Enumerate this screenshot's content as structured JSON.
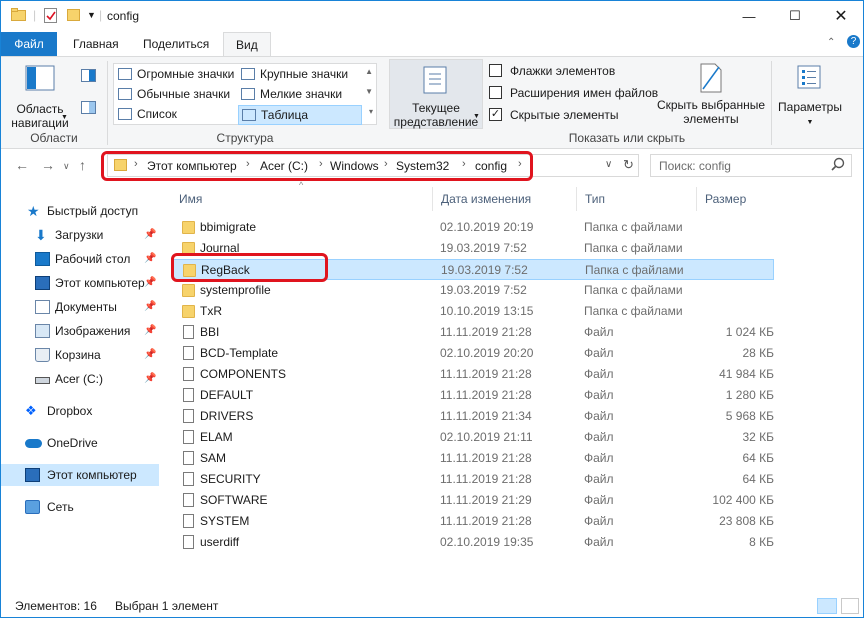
{
  "title": "config",
  "tabs": [
    {
      "label": "Файл"
    },
    {
      "label": "Главная"
    },
    {
      "label": "Поделиться"
    },
    {
      "label": "Вид"
    }
  ],
  "ribbon": {
    "nav_area_label": "Область\nнавигации",
    "group_panels": "Области",
    "layouts": {
      "huge": "Огромные значки",
      "large": "Крупные значки",
      "normal": "Обычные значки",
      "small": "Мелкие значки",
      "list": "Список",
      "table": "Таблица"
    },
    "group_structure": "Структура",
    "current_view": "Текущее\nпредставление",
    "checkboxes": {
      "item_flags": "Флажки элементов",
      "extensions": "Расширения имен файлов",
      "hidden": "Скрытые элементы"
    },
    "hide_selected": "Скрыть выбранные\nэлементы",
    "group_show_hide": "Показать или скрыть",
    "parameters": "Параметры"
  },
  "address": {
    "crumbs": [
      "Этот компьютер",
      "Acer (C:)",
      "Windows",
      "System32",
      "config"
    ],
    "search_placeholder": "Поиск: config"
  },
  "nav": {
    "quick_access": "Быстрый доступ",
    "items": [
      {
        "label": "Загрузки"
      },
      {
        "label": "Рабочий стол"
      },
      {
        "label": "Этот компьютер"
      },
      {
        "label": "Документы"
      },
      {
        "label": "Изображения"
      },
      {
        "label": "Корзина"
      },
      {
        "label": "Acer (C:)"
      }
    ],
    "dropbox": "Dropbox",
    "onedrive": "OneDrive",
    "this_pc": "Этот компьютер",
    "network": "Сеть"
  },
  "columns": {
    "name": "Имя",
    "date": "Дата изменения",
    "type": "Тип",
    "size": "Размер"
  },
  "files": [
    {
      "name": "bbimigrate",
      "date": "02.10.2019 20:19",
      "type": "Папка с файлами",
      "size": "",
      "kind": "folder"
    },
    {
      "name": "Journal",
      "date": "19.03.2019 7:52",
      "type": "Папка с файлами",
      "size": "",
      "kind": "folder"
    },
    {
      "name": "RegBack",
      "date": "19.03.2019 7:52",
      "type": "Папка с файлами",
      "size": "",
      "kind": "folder"
    },
    {
      "name": "systemprofile",
      "date": "19.03.2019 7:52",
      "type": "Папка с файлами",
      "size": "",
      "kind": "folder"
    },
    {
      "name": "TxR",
      "date": "10.10.2019 13:15",
      "type": "Папка с файлами",
      "size": "",
      "kind": "folder"
    },
    {
      "name": "BBI",
      "date": "11.11.2019 21:28",
      "type": "Файл",
      "size": "1 024 КБ",
      "kind": "file"
    },
    {
      "name": "BCD-Template",
      "date": "02.10.2019 20:20",
      "type": "Файл",
      "size": "28 КБ",
      "kind": "file"
    },
    {
      "name": "COMPONENTS",
      "date": "11.11.2019 21:28",
      "type": "Файл",
      "size": "41 984 КБ",
      "kind": "file"
    },
    {
      "name": "DEFAULT",
      "date": "11.11.2019 21:28",
      "type": "Файл",
      "size": "1 280 КБ",
      "kind": "file"
    },
    {
      "name": "DRIVERS",
      "date": "11.11.2019 21:34",
      "type": "Файл",
      "size": "5 968 КБ",
      "kind": "file"
    },
    {
      "name": "ELAM",
      "date": "02.10.2019 21:11",
      "type": "Файл",
      "size": "32 КБ",
      "kind": "file"
    },
    {
      "name": "SAM",
      "date": "11.11.2019 21:28",
      "type": "Файл",
      "size": "64 КБ",
      "kind": "file"
    },
    {
      "name": "SECURITY",
      "date": "11.11.2019 21:28",
      "type": "Файл",
      "size": "64 КБ",
      "kind": "file"
    },
    {
      "name": "SOFTWARE",
      "date": "11.11.2019 21:29",
      "type": "Файл",
      "size": "102 400 КБ",
      "kind": "file"
    },
    {
      "name": "SYSTEM",
      "date": "11.11.2019 21:28",
      "type": "Файл",
      "size": "23 808 КБ",
      "kind": "file"
    },
    {
      "name": "userdiff",
      "date": "02.10.2019 19:35",
      "type": "Файл",
      "size": "8 КБ",
      "kind": "file"
    }
  ],
  "status": {
    "count": "Элементов: 16",
    "selected": "Выбран 1 элемент"
  },
  "colors": {
    "accent": "#1979ca",
    "selection": "#cce8ff",
    "highlight": "#e0141e"
  }
}
